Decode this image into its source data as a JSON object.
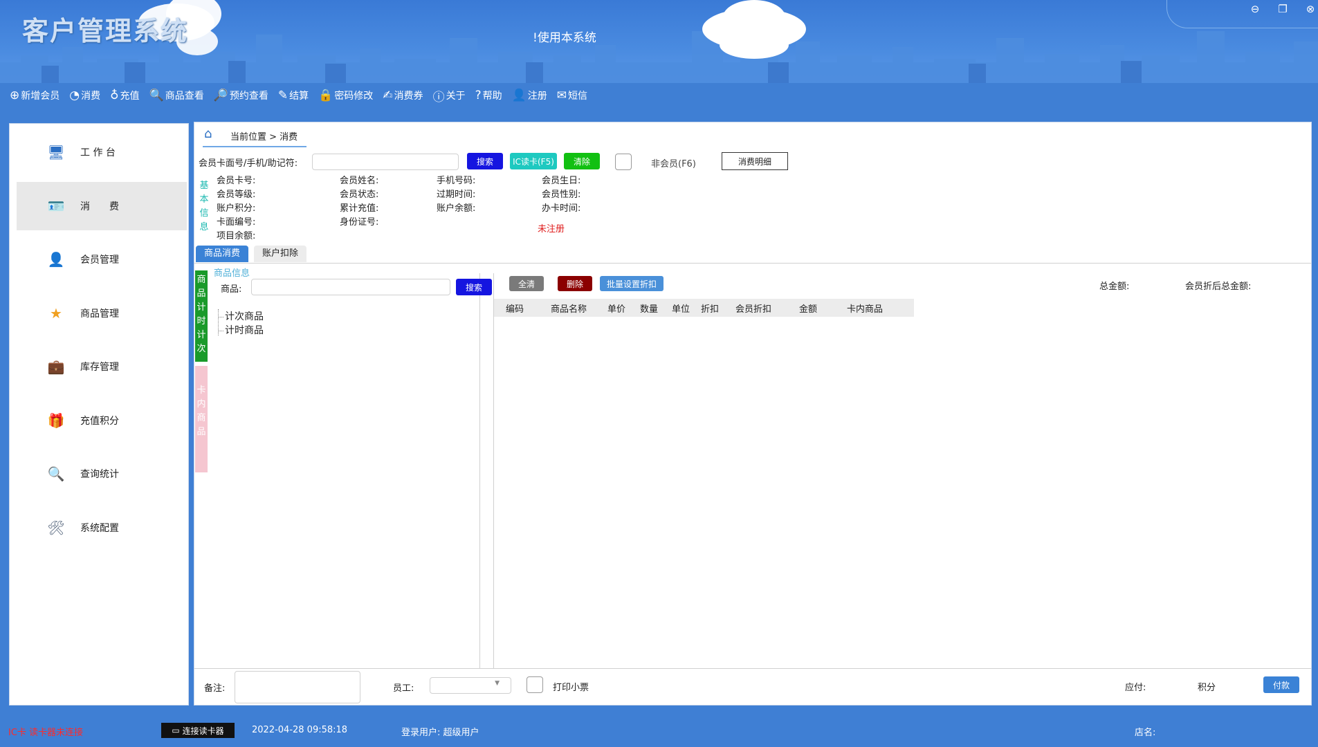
{
  "app": {
    "title": "客户管理系统",
    "notice": "!使用本系统"
  },
  "toolbar": [
    {
      "icon": "plus-circle-icon",
      "glyph": "⊕",
      "label": "新增会员"
    },
    {
      "icon": "pie-chart-icon",
      "glyph": "◔",
      "label": "消费"
    },
    {
      "icon": "money-bag-icon",
      "glyph": "♁",
      "label": "充值"
    },
    {
      "icon": "search-icon",
      "glyph": "🔍",
      "label": "商品查看"
    },
    {
      "icon": "search-plus-icon",
      "glyph": "🔎",
      "label": "预约查看"
    },
    {
      "icon": "pencil-icon",
      "glyph": "✎",
      "label": "结算"
    },
    {
      "icon": "lock-icon",
      "glyph": "🔒",
      "label": "密码修改"
    },
    {
      "icon": "ticket-edit-icon",
      "glyph": "✍",
      "label": "消费券"
    },
    {
      "icon": "info-icon",
      "glyph": "ⓘ",
      "label": "关于"
    },
    {
      "icon": "help-icon",
      "glyph": "?",
      "label": "帮助"
    },
    {
      "icon": "user-icon",
      "glyph": "👤",
      "label": "注册"
    },
    {
      "icon": "mail-icon",
      "glyph": "✉",
      "label": "短信"
    }
  ],
  "sidebar": [
    {
      "icon": "monitor-icon",
      "glyph": "🖥",
      "label": "工 作 台",
      "color": "#2b6fc4",
      "active": false
    },
    {
      "icon": "id-card-icon",
      "glyph": "🪪",
      "label": "消　　费",
      "color": "#5b7fa6",
      "active": true
    },
    {
      "icon": "person-icon",
      "glyph": "👤",
      "label": "会员管理",
      "color": "#3a3a3a",
      "active": false
    },
    {
      "icon": "star-icon",
      "glyph": "★",
      "label": "商品管理",
      "color": "#f0a020",
      "active": false
    },
    {
      "icon": "briefcase-icon",
      "glyph": "💼",
      "label": "库存管理",
      "color": "#8a4a1a",
      "active": false
    },
    {
      "icon": "gift-icon",
      "glyph": "🎁",
      "label": "充值积分",
      "color": "#e08a1e",
      "active": false
    },
    {
      "icon": "magnifier-icon",
      "glyph": "🔍",
      "label": "查询统计",
      "color": "#777",
      "active": false
    },
    {
      "icon": "tools-icon",
      "glyph": "🛠",
      "label": "系统配置",
      "color": "#5a6a80",
      "active": false
    }
  ],
  "breadcrumb": {
    "label": "当前位置 > 消费"
  },
  "search": {
    "label": "会员卡面号/手机/助记符:",
    "value": "",
    "search_btn": "搜索",
    "ic_btn": "IC读卡(F5)",
    "clear_btn": "清除",
    "non_member_label": "非会员(F6)",
    "detail_btn": "消费明细"
  },
  "basic_info": {
    "side_label": "基本信息",
    "fields": [
      "会员卡号:",
      "会员姓名:",
      "手机号码:",
      "会员生日:",
      "会员等级:",
      "会员状态:",
      "过期时间:",
      "会员性别:",
      "账户积分:",
      "累计充值:",
      "账户余额:",
      "办卡时间:",
      "卡面编号:",
      "身份证号:",
      "项目余额:"
    ],
    "status": "未注册"
  },
  "tabs": [
    {
      "label": "商品消费",
      "active": true
    },
    {
      "label": "账户扣除",
      "active": false
    }
  ],
  "left_panel": {
    "vtab_green": "商品计时计次",
    "vtab_pink": "卡内商品",
    "group_title": "商品信息",
    "product_label": "商品:",
    "search_btn": "搜索",
    "tree": [
      "计次商品",
      "计时商品"
    ]
  },
  "right_panel": {
    "clear_all_btn": "全清",
    "delete_btn": "删除",
    "batch_discount_btn": "批量设置折扣",
    "total_label": "总金额:",
    "member_total_label": "会员折后总金额:",
    "columns": [
      "编码",
      "商品名称",
      "单价",
      "数量",
      "单位",
      "折扣",
      "会员折扣",
      "金额",
      "卡内商品"
    ]
  },
  "footer": {
    "remark_label": "备注:",
    "staff_label": "员工:",
    "print_label": "打印小票",
    "payable_label": "应付:",
    "points_label": "积分",
    "pay_btn": "付款"
  },
  "status": {
    "reader_status": "IC卡 读卡器未连接",
    "connect_btn": "连接读卡器",
    "datetime": "2022-04-28 09:58:18",
    "login_user": "登录用户: 超级用户",
    "shop": "店名:"
  }
}
